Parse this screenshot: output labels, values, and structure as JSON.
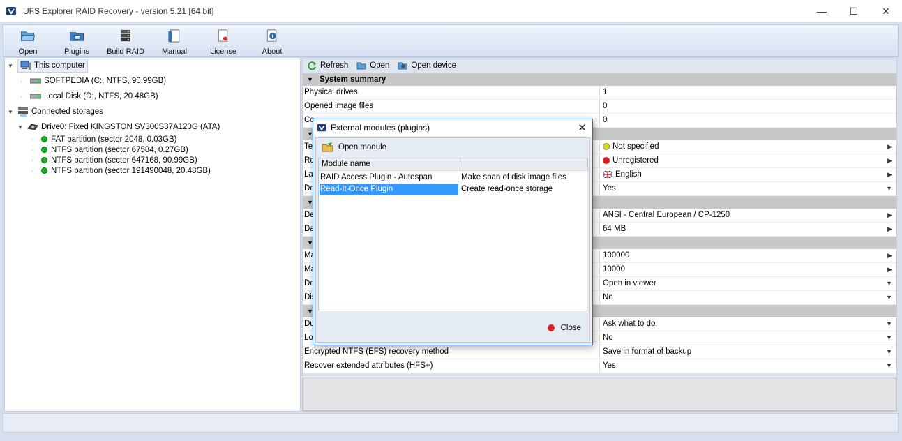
{
  "window": {
    "title": "UFS Explorer RAID Recovery - version 5.21 [64 bit]"
  },
  "toolbar": {
    "items": [
      "Open",
      "Plugins",
      "Build RAID",
      "Manual",
      "License",
      "About"
    ]
  },
  "tree": {
    "this_computer": "This computer",
    "disk_c": "SOFTPEDIA (C:, NTFS, 90.99GB)",
    "disk_d": "Local Disk (D:, NTFS, 20.48GB)",
    "connected": "Connected storages",
    "drive0": "Drive0: Fixed KINGSTON SV300S37A120G (ATA)",
    "partitions": [
      "FAT partition (sector 2048, 0.03GB)",
      "NTFS partition (sector 67584, 0.27GB)",
      "NTFS partition (sector 647168, 90.99GB)",
      "NTFS partition (sector 191490048, 20.48GB)"
    ]
  },
  "right_toolbar": {
    "refresh": "Refresh",
    "open": "Open",
    "open_device": "Open device"
  },
  "grid": {
    "section_title": "System summary",
    "rows": [
      {
        "name": "Physical drives",
        "value": "1"
      },
      {
        "name": "Opened image files",
        "value": "0"
      },
      {
        "name": "Co",
        "value": "0"
      },
      {
        "name": "Te",
        "value": "Not specified"
      },
      {
        "name": "Re",
        "value": "Unregistered"
      },
      {
        "name": "La",
        "value": "English"
      },
      {
        "name": "De",
        "value": "Yes"
      },
      {
        "name": "De",
        "value": "ANSI - Central European / CP-1250"
      },
      {
        "name": "Da",
        "value": "64 MB"
      },
      {
        "name": "Ma",
        "value": "100000"
      },
      {
        "name": "Ma",
        "value": "10000"
      },
      {
        "name": "De",
        "value": "Open in viewer"
      },
      {
        "name": "Dis",
        "value": "No"
      },
      {
        "name": "Du",
        "value": "Ask what to do"
      },
      {
        "name": "Lo",
        "value": "No"
      },
      {
        "name": "Encrypted NTFS (EFS) recovery method",
        "value": "Save in format of backup"
      },
      {
        "name": "Recover extended attributes (HFS+)",
        "value": "Yes"
      }
    ]
  },
  "dialog": {
    "title": "External modules (plugins)",
    "open_module": "Open module",
    "col_name": "Module name",
    "modules": [
      {
        "name": "RAID Access Plugin - Autospan",
        "desc": "Make span of disk image files"
      },
      {
        "name": "Read-It-Once Plugin",
        "desc": "Create read-once storage"
      }
    ],
    "close": "Close"
  },
  "colors": {
    "selection": "#3399ff",
    "section_header": "#c8c8c8",
    "status_green": "#18b018"
  }
}
